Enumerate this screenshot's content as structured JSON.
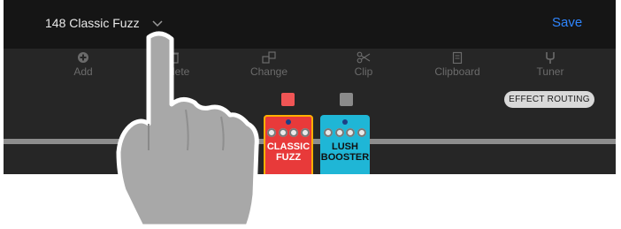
{
  "header": {
    "preset_name": "148 Classic Fuzz",
    "save_label": "Save"
  },
  "toolbar": {
    "items": [
      {
        "label": "Add",
        "icon": "plus-circle-icon"
      },
      {
        "label": "Delete",
        "icon": "trash-icon"
      },
      {
        "label": "Change",
        "icon": "change-icon"
      },
      {
        "label": "Clip",
        "icon": "scissors-icon"
      },
      {
        "label": "Clipboard",
        "icon": "clipboard-icon"
      },
      {
        "label": "Tuner",
        "icon": "tuner-fork-icon"
      }
    ]
  },
  "routing_button": "EFFECT ROUTING",
  "pedals": [
    {
      "line1": "CLASSIC",
      "line2": "FUZZ",
      "color": "#e83a3a",
      "selector_color": "#f05555",
      "selected": true
    },
    {
      "line1": "LUSH",
      "line2": "BOOSTER",
      "color": "#1fb6d6",
      "selector_color": "#8a8a8a",
      "selected": false
    }
  ],
  "colors": {
    "accent": "#2f86ff",
    "topbar": "#151515",
    "workspace": "#262626",
    "hand_fill": "#a8a8a8"
  },
  "overlay": "pointing-hand-cursor"
}
